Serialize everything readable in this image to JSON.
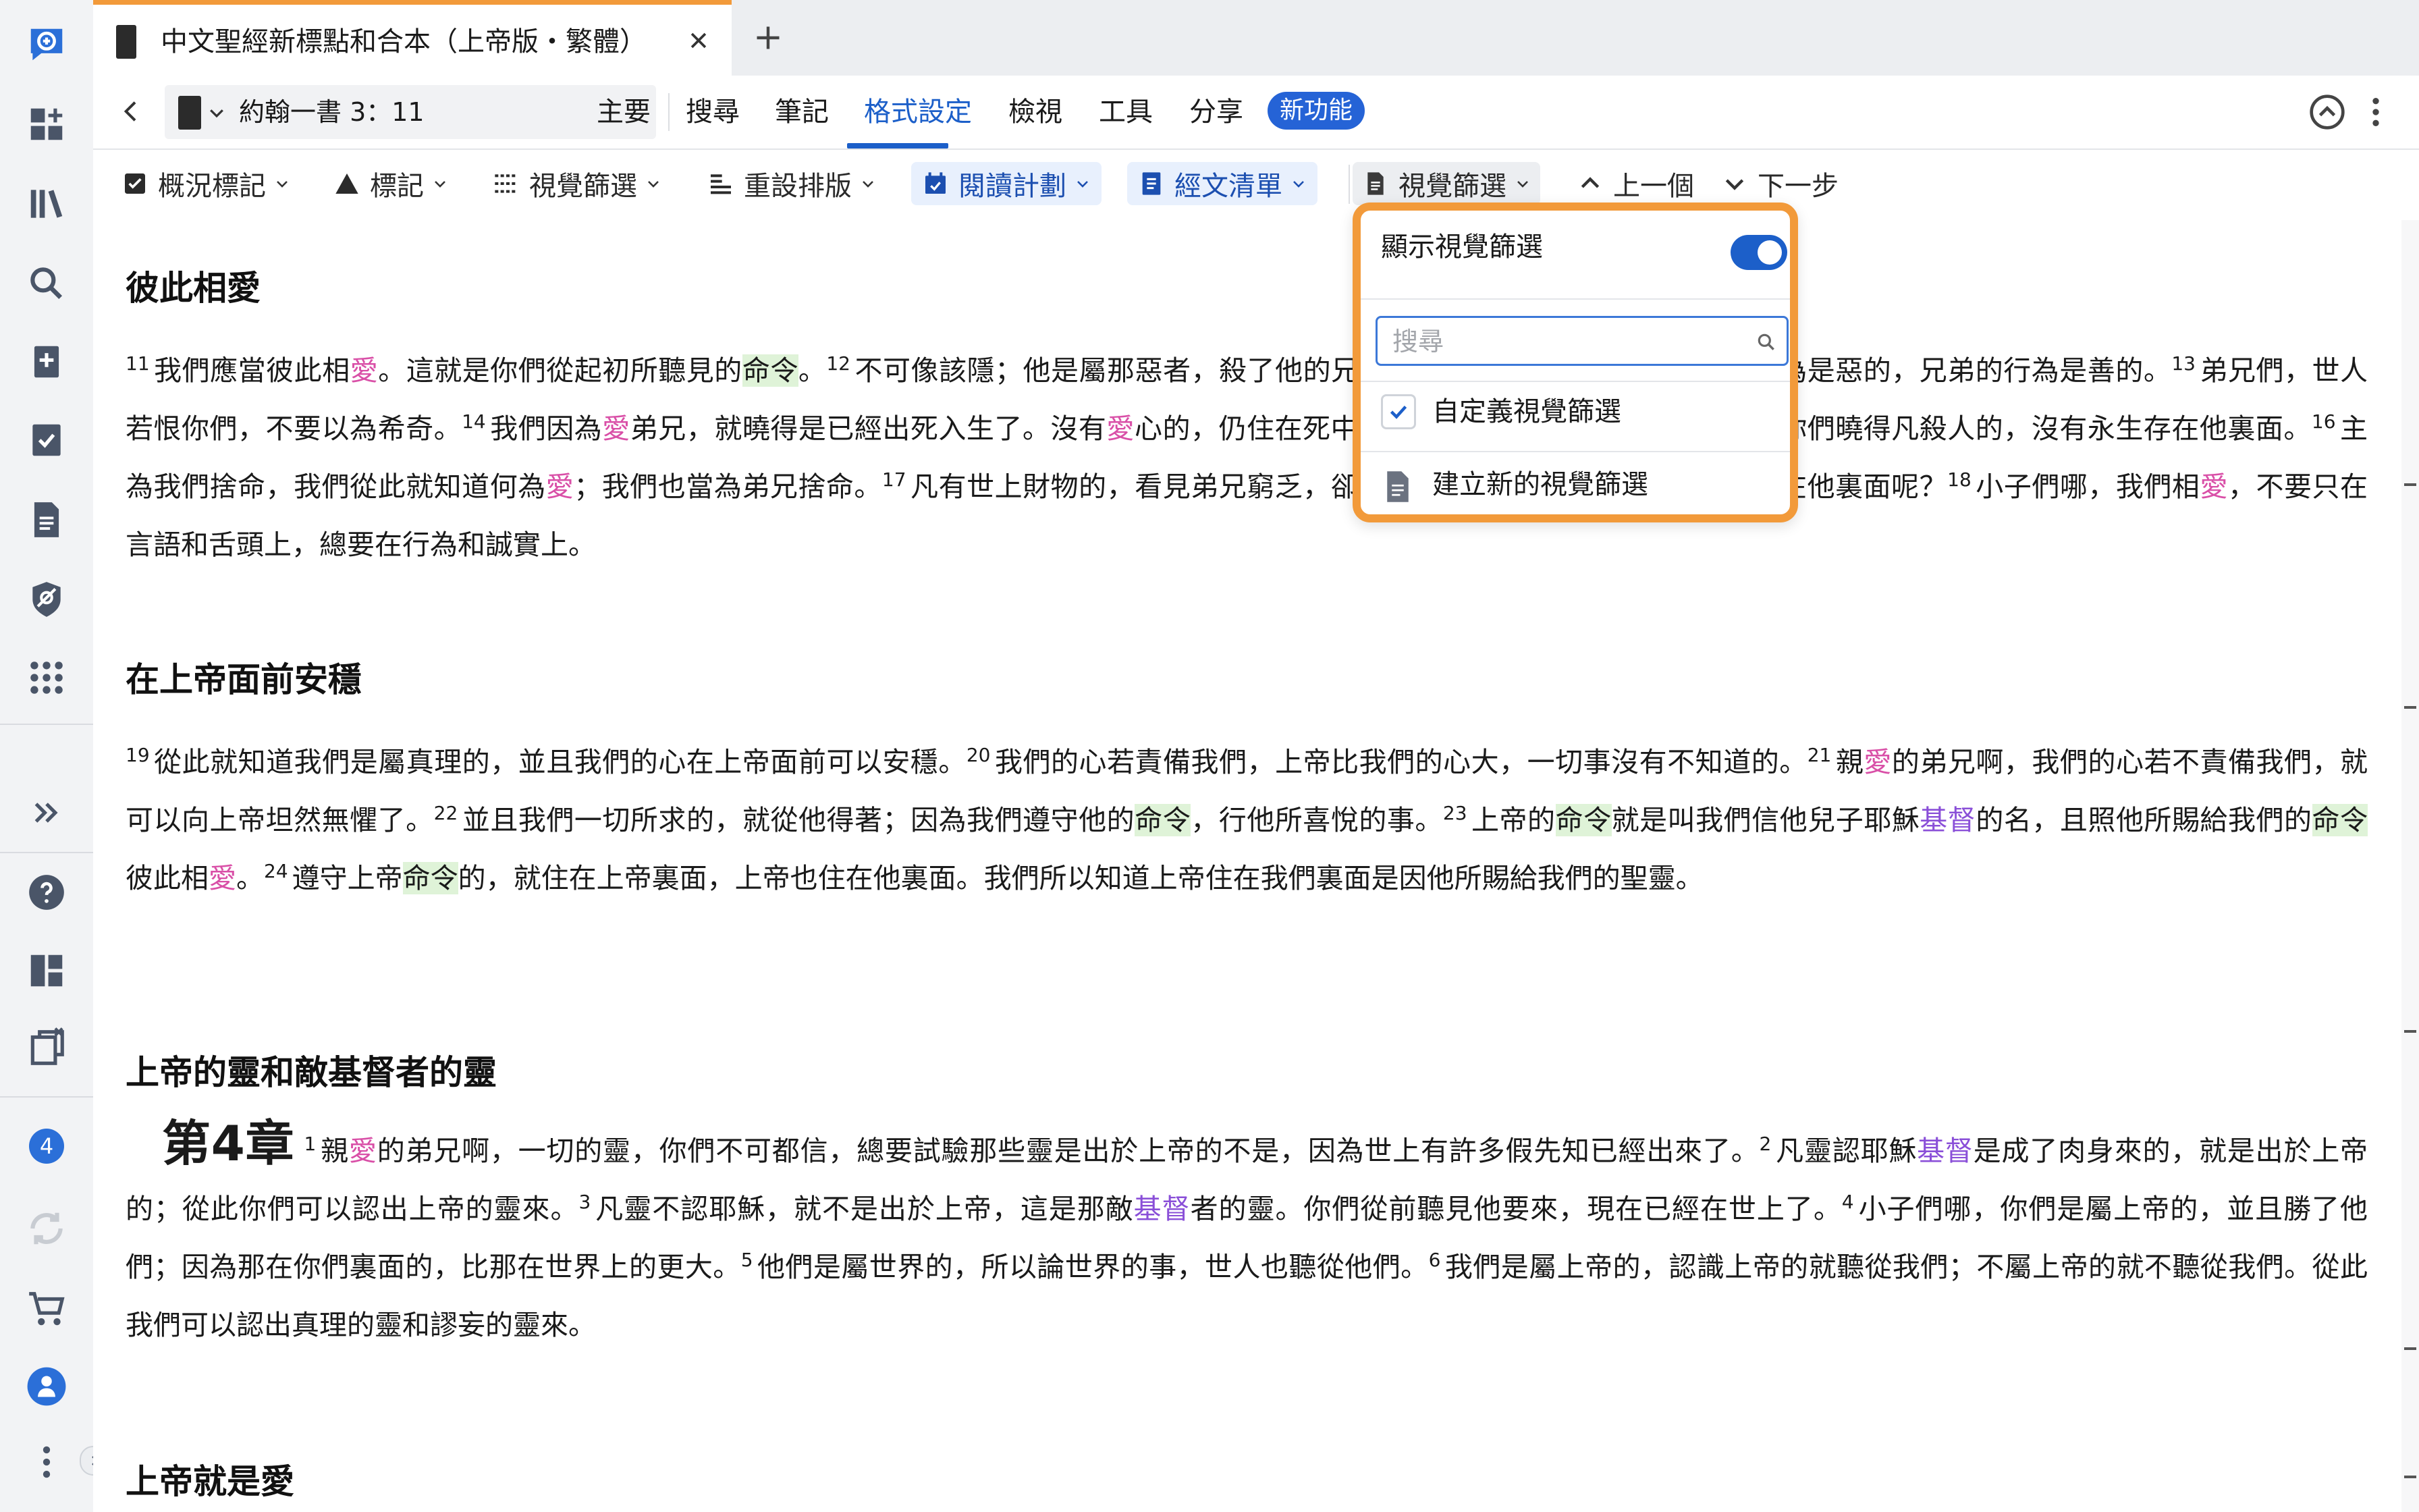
{
  "app": {
    "tab_title": "中文聖經新標點和合本（上帝版・繁體）",
    "accent_color": "#f29a3a",
    "brand_blue": "#1c5fc9"
  },
  "nav": {
    "reference": "約翰一書 3：11",
    "menus": [
      "主要",
      "搜尋",
      "筆記",
      "格式設定",
      "檢視",
      "工具",
      "分享"
    ],
    "active_menu": "格式設定",
    "new_badge": "新功能"
  },
  "toolbar": {
    "items": [
      {
        "label": "概況標記",
        "icon": "checkbox-icon"
      },
      {
        "label": "標記",
        "icon": "triangle-icon"
      },
      {
        "label": "視覺篩選",
        "icon": "filter-icon"
      },
      {
        "label": "重設排版",
        "icon": "text-layout-icon"
      },
      {
        "label": "閱讀計劃",
        "icon": "calendar-icon"
      },
      {
        "label": "經文清單",
        "icon": "list-icon"
      },
      {
        "label": "視覺篩選",
        "icon": "document-icon"
      }
    ],
    "prev": "上一個",
    "next": "下一步"
  },
  "popup": {
    "show_label": "顯示視覺篩選",
    "toggle_on": true,
    "search_placeholder": "搜尋",
    "custom_label": "自定義視覺篩選",
    "custom_checked": true,
    "new_label": "建立新的視覺篩選"
  },
  "rail": {
    "badge_count": "4",
    "icons": [
      "add-search-icon",
      "dashboard-add-icon",
      "library-icon",
      "search-icon",
      "bookmark-add-icon",
      "checklist-icon",
      "document-icon",
      "eye-off-icon",
      "apps-grid-icon",
      "expand-icon",
      "help-icon",
      "layout-icon",
      "clipboard-close-icon",
      "notification-badge",
      "sync-icon",
      "cart-icon",
      "user-icon",
      "more-icon"
    ]
  },
  "content": {
    "h1": "彼此相愛",
    "h2": "在上帝面前安穩",
    "h3": "上帝的靈和敵基督者的靈",
    "h4": "上帝就是愛",
    "chapter_label": "第4章"
  }
}
